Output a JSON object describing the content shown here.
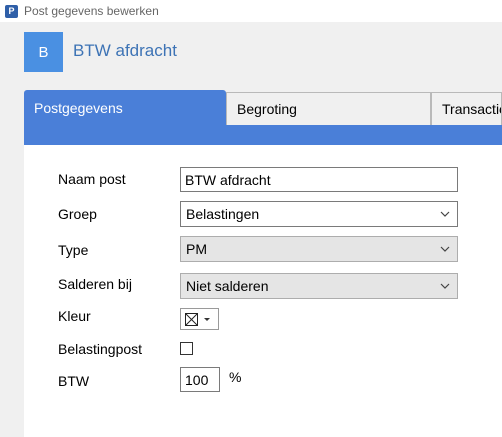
{
  "window": {
    "title": "Post gegevens bewerken",
    "app_icon_letter": "P"
  },
  "header": {
    "badge_letter": "B",
    "title": "BTW afdracht"
  },
  "tabs": [
    {
      "label": "Postgegevens",
      "active": true
    },
    {
      "label": "Begroting",
      "active": false
    },
    {
      "label": "Transacties",
      "active": false
    }
  ],
  "form": {
    "naam_post": {
      "label": "Naam post",
      "value": "BTW afdracht"
    },
    "groep": {
      "label": "Groep",
      "value": "Belastingen"
    },
    "type": {
      "label": "Type",
      "value": "PM"
    },
    "salderen_bij": {
      "label": "Salderen bij",
      "value": "Niet salderen"
    },
    "kleur": {
      "label": "Kleur"
    },
    "belastingpost": {
      "label": "Belastingpost",
      "checked": false
    },
    "btw": {
      "label": "BTW",
      "value": "100",
      "unit": "%"
    }
  },
  "colors": {
    "accent": "#4a7fd8",
    "badge": "#4a90e2",
    "title_text": "#3d73b5"
  }
}
